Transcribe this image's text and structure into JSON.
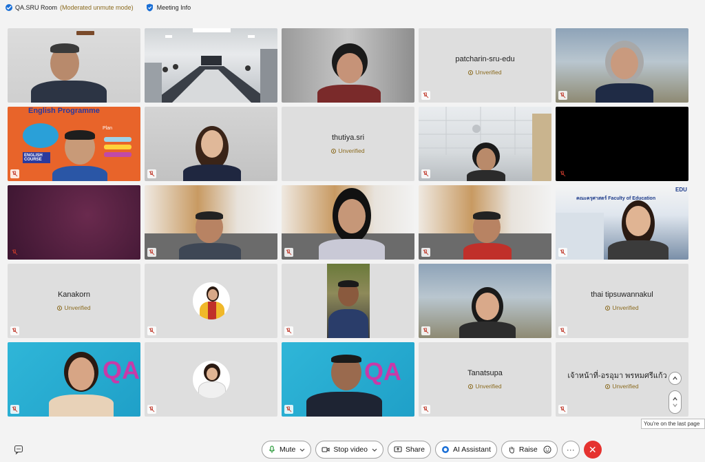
{
  "topbar": {
    "room_name": "QA.SRU Room",
    "room_mode": "(Moderated unmute mode)",
    "meeting_info": "Meeting Info"
  },
  "tiles": {
    "t1": {
      "type": "video"
    },
    "t2": {
      "type": "video"
    },
    "t3": {
      "type": "video"
    },
    "t4": {
      "type": "name",
      "name": "patcharin-sru-edu",
      "status": "Unverified"
    },
    "t5": {
      "type": "video"
    },
    "t6": {
      "type": "video",
      "banner": "English Programme",
      "course": "ENGLISH COURSE",
      "plan": "Plan"
    },
    "t7": {
      "type": "video"
    },
    "t8": {
      "type": "name",
      "name": "thutiya.sri",
      "status": "Unverified"
    },
    "t9": {
      "type": "video"
    },
    "t10": {
      "type": "blank"
    },
    "t11": {
      "type": "blank"
    },
    "t12": {
      "type": "video"
    },
    "t13": {
      "type": "video"
    },
    "t14": {
      "type": "video"
    },
    "t15": {
      "type": "video",
      "banner": "คณะครุศาสตร์ Faculty of Education",
      "tag": "EDU"
    },
    "t16": {
      "type": "name",
      "name": "Kanakorn",
      "status": "Unverified"
    },
    "t17": {
      "type": "avatar"
    },
    "t18": {
      "type": "video"
    },
    "t19": {
      "type": "video"
    },
    "t20": {
      "type": "name",
      "name": "thai tipsuwannakul",
      "status": "Unverified"
    },
    "t21": {
      "type": "video",
      "logo": "QA"
    },
    "t22": {
      "type": "avatar"
    },
    "t23": {
      "type": "video",
      "logo": "QA"
    },
    "t24": {
      "type": "name",
      "name": "Tanatsupa",
      "status": "Unverified"
    },
    "t25": {
      "type": "name",
      "name": "เจ้าหน้าที่-อรอุมา พรหมศรีแก้ว",
      "status": "Unverified"
    }
  },
  "tooltip": "You're on the last page",
  "toolbar": {
    "mute": "Mute",
    "stop_video": "Stop video",
    "share": "Share",
    "ai_assistant": "AI Assistant",
    "raise": "Raise",
    "more": "···"
  },
  "colors": {
    "unverified": "#8a6a1e",
    "end": "#e5322f",
    "accent": "#1a6fd6"
  }
}
